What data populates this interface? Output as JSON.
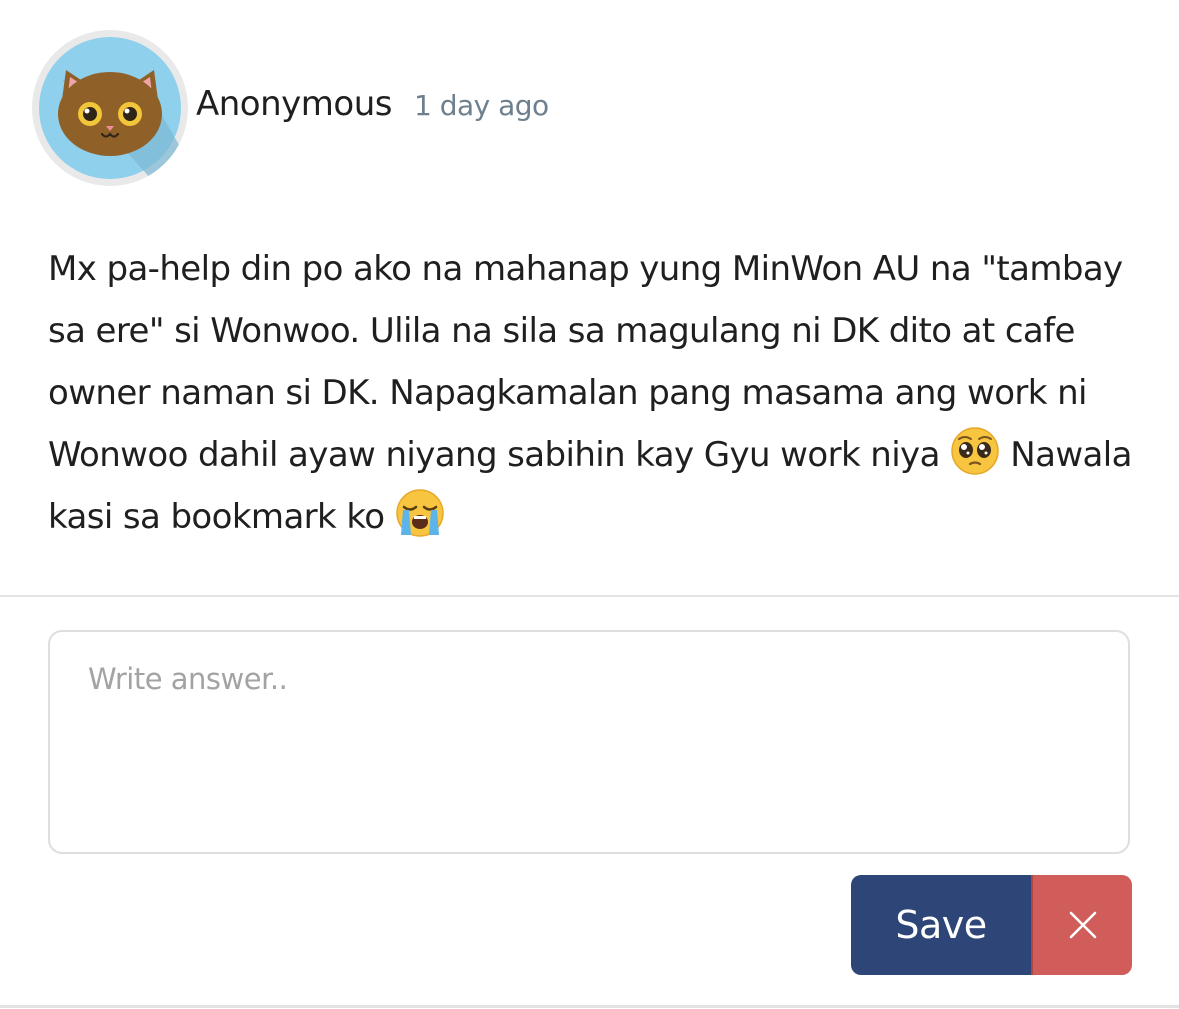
{
  "post": {
    "author": "Anonymous",
    "timestamp": "1 day ago",
    "avatar_icon": "cat-face-icon",
    "body_part1": "Mx pa-help din po ako na mahanap yung MinWon AU na \"tambay sa ere\" si Wonwoo. Ulila na sila sa magulang ni DK dito at cafe owner naman si DK. Napagkamalan pang masama ang work ni Wonwoo dahil ayaw niyang sabihin kay Gyu work niya",
    "emoji_1": "pleading-face-emoji",
    "body_part2": " Nawala kasi sa bookmark ko",
    "emoji_2": "loudly-crying-face-emoji"
  },
  "answer": {
    "placeholder": "Write answer..",
    "value": ""
  },
  "actions": {
    "save_label": "Save",
    "close_icon": "close-icon"
  },
  "colors": {
    "save_button": "#2e4677",
    "close_button": "#d15d5a",
    "timestamp": "#6e7f8e",
    "avatar_bg": "#8fd0ec"
  }
}
